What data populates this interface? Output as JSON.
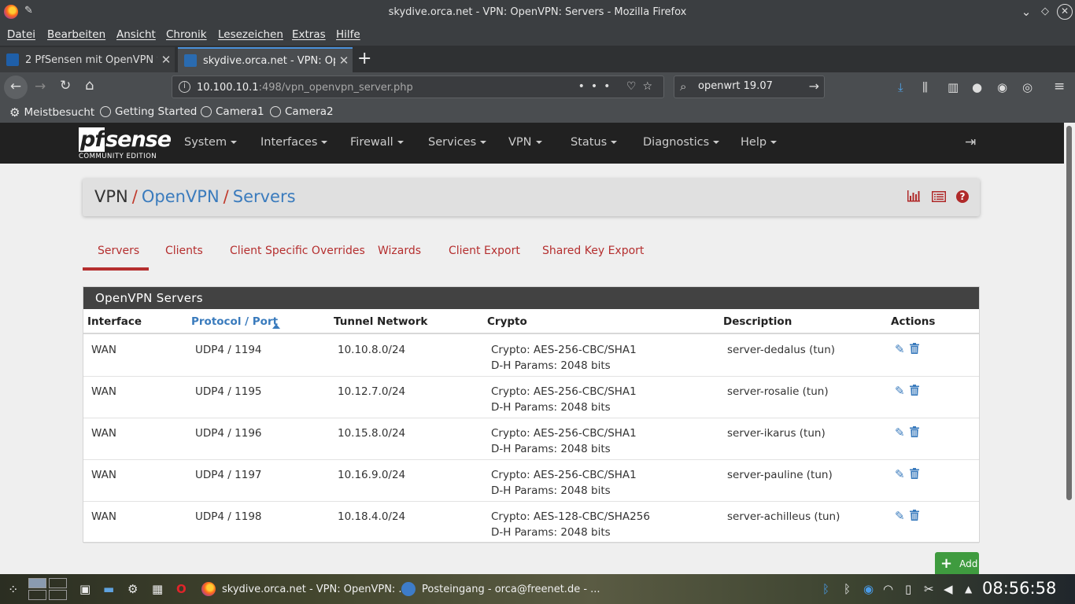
{
  "window": {
    "title": "skydive.orca.net - VPN: OpenVPN: Servers - Mozilla Firefox"
  },
  "menubar": [
    "Datei",
    "Bearbeiten",
    "Ansicht",
    "Chronik",
    "Lesezeichen",
    "Extras",
    "Hilfe"
  ],
  "tabs": [
    {
      "label": "2 PfSensen mit OpenVPN v",
      "active": false
    },
    {
      "label": "skydive.orca.net - VPN: Op",
      "active": true
    }
  ],
  "nav": {
    "url_host": "10.100.10.1",
    "url_rest": ":498/vpn_openvpn_server.php",
    "url_more": "•••",
    "search_value": "openwrt 19.07"
  },
  "bookmarks": [
    "Meistbesucht",
    "Getting Started",
    "Camera1",
    "Camera2"
  ],
  "pfsense": {
    "logo_main_pf": "pf",
    "logo_main_rest": "sense",
    "logo_sub": "COMMUNITY EDITION",
    "menu": [
      "System",
      "Interfaces",
      "Firewall",
      "Services",
      "VPN",
      "Status",
      "Diagnostics",
      "Help"
    ]
  },
  "breadcrumb": {
    "root": "VPN",
    "sep": "/",
    "level1": "OpenVPN",
    "level2": "Servers"
  },
  "subtabs": [
    "Servers",
    "Clients",
    "Client Specific Overrides",
    "Wizards",
    "Client Export",
    "Shared Key Export"
  ],
  "table": {
    "heading": "OpenVPN Servers",
    "columns": [
      "Interface",
      "Protocol / Port",
      "Tunnel Network",
      "Crypto",
      "Description",
      "Actions"
    ],
    "rows": [
      {
        "iface": "WAN",
        "proto": "UDP4 / 1194",
        "tunnel": "10.10.8.0/24",
        "crypto": "Crypto: AES-256-CBC/SHA1",
        "dh": "D-H Params: 2048 bits",
        "desc": "server-dedalus (tun)"
      },
      {
        "iface": "WAN",
        "proto": "UDP4 / 1195",
        "tunnel": "10.12.7.0/24",
        "crypto": "Crypto: AES-256-CBC/SHA1",
        "dh": "D-H Params: 2048 bits",
        "desc": "server-rosalie (tun)"
      },
      {
        "iface": "WAN",
        "proto": "UDP4 / 1196",
        "tunnel": "10.15.8.0/24",
        "crypto": "Crypto: AES-256-CBC/SHA1",
        "dh": "D-H Params: 2048 bits",
        "desc": "server-ikarus (tun)"
      },
      {
        "iface": "WAN",
        "proto": "UDP4 / 1197",
        "tunnel": "10.16.9.0/24",
        "crypto": "Crypto: AES-256-CBC/SHA1",
        "dh": "D-H Params: 2048 bits",
        "desc": "server-pauline (tun)"
      },
      {
        "iface": "WAN",
        "proto": "UDP4 / 1198",
        "tunnel": "10.18.4.0/24",
        "crypto": "Crypto: AES-128-CBC/SHA256",
        "dh": "D-H Params: 2048 bits",
        "desc": "server-achilleus (tun)"
      }
    ]
  },
  "add_button": "Add",
  "taskbar": {
    "task1": "skydive.orca.net - VPN: OpenVPN: ...",
    "task2": "Posteingang - orca@freenet.de - ...",
    "clock": "08:56:58"
  },
  "colors": {
    "pf_red": "#b52f2f",
    "pf_blue": "#3a7bbd",
    "pf_green": "#3f9b3f",
    "pf_dark": "#212121"
  }
}
